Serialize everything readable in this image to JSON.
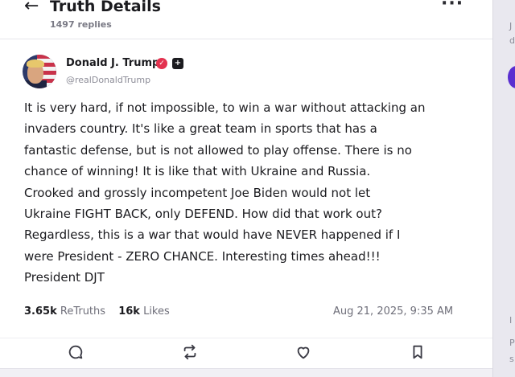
{
  "header": {
    "title": "Truth Details",
    "reply_count": "1497 replies",
    "back_icon": "arrow-left-icon",
    "more_icon": "ellipsis-icon"
  },
  "post": {
    "author_name": "Donald J. Trump",
    "handle": "@realDonaldTrump",
    "verified_icon": "verified-check-icon",
    "badge_icon": "plus-badge-icon",
    "body_lines": [
      "It is very hard, if not impossible, to win a war without attacking an",
      "invaders country. It's like a great team in sports that has a",
      "fantastic defense, but is not allowed to play offense. There is no",
      "chance of winning! It is like that with Ukraine and Russia.",
      "Crooked and grossly incompetent Joe Biden would not let",
      "Ukraine FIGHT BACK, only DEFEND. How did that work out?",
      "Regardless, this is a war that would have NEVER happened if I",
      "were President - ZERO CHANCE. Interesting times ahead!!!",
      "President DJT"
    ],
    "stats": {
      "retruths_count": "3.65k",
      "retruths_label": "ReTruths",
      "likes_count": "16k",
      "likes_label": "Likes"
    },
    "timestamp": "Aug 21, 2025, 9:35 AM"
  },
  "actions": [
    {
      "name": "reply-button",
      "icon": "comment-icon"
    },
    {
      "name": "retruth-button",
      "icon": "repost-icon"
    },
    {
      "name": "like-button",
      "icon": "heart-icon"
    },
    {
      "name": "bookmark-button",
      "icon": "bookmark-icon"
    }
  ],
  "colors": {
    "accent_verified": "#e3324f",
    "text_primary": "#1b1b1f",
    "text_secondary": "#6f6f7a",
    "sidebar_accent": "#5a2fd0"
  }
}
